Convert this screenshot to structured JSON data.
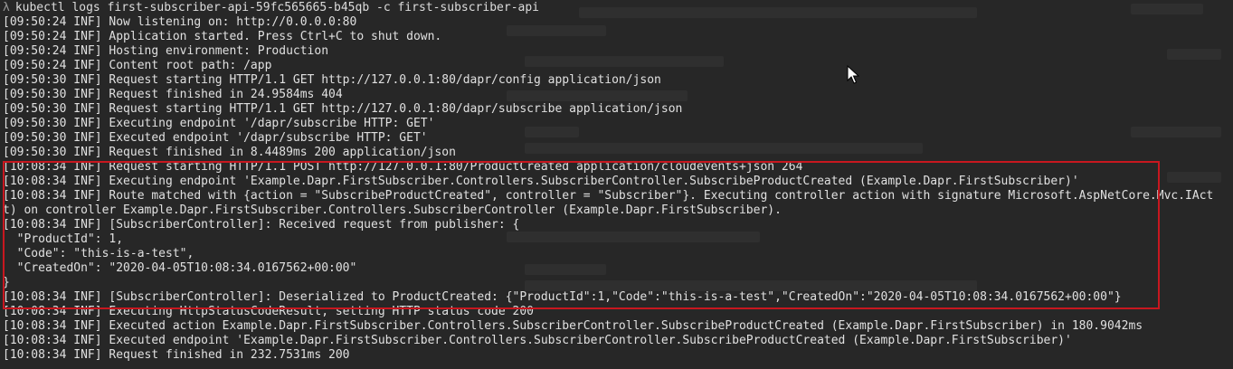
{
  "terminal": {
    "prompt_symbol": "λ",
    "command": "kubectl logs first-subscriber-api-59fc565665-b45qb -c first-subscriber-api",
    "lines": [
      "[09:50:24 INF] Now listening on: http://0.0.0.0:80",
      "[09:50:24 INF] Application started. Press Ctrl+C to shut down.",
      "[09:50:24 INF] Hosting environment: Production",
      "[09:50:24 INF] Content root path: /app",
      "[09:50:30 INF] Request starting HTTP/1.1 GET http://127.0.0.1:80/dapr/config application/json",
      "[09:50:30 INF] Request finished in 24.9584ms 404",
      "[09:50:30 INF] Request starting HTTP/1.1 GET http://127.0.0.1:80/dapr/subscribe application/json",
      "[09:50:30 INF] Executing endpoint '/dapr/subscribe HTTP: GET'",
      "[09:50:30 INF] Executed endpoint '/dapr/subscribe HTTP: GET'",
      "[09:50:30 INF] Request finished in 8.4489ms 200 application/json",
      "[10:08:34 INF] Request starting HTTP/1.1 POST http://127.0.0.1:80/ProductCreated application/cloudevents+json 264",
      "[10:08:34 INF] Executing endpoint 'Example.Dapr.FirstSubscriber.Controllers.SubscriberController.SubscribeProductCreated (Example.Dapr.FirstSubscriber)'",
      "[10:08:34 INF] Route matched with {action = \"SubscribeProductCreated\", controller = \"Subscriber\"}. Executing controller action with signature Microsoft.AspNetCore.Mvc.IAct",
      "t) on controller Example.Dapr.FirstSubscriber.Controllers.SubscriberController (Example.Dapr.FirstSubscriber).",
      "[10:08:34 INF] [SubscriberController]: Received request from publisher: {",
      "  \"ProductId\": 1,",
      "  \"Code\": \"this-is-a-test\",",
      "  \"CreatedOn\": \"2020-04-05T10:08:34.0167562+00:00\"",
      "}",
      "[10:08:34 INF] [SubscriberController]: Deserialized to ProductCreated: {\"ProductId\":1,\"Code\":\"this-is-a-test\",\"CreatedOn\":\"2020-04-05T10:08:34.0167562+00:00\"}",
      "[10:08:34 INF] Executing HttpStatusCodeResult, setting HTTP status code 200",
      "[10:08:34 INF] Executed action Example.Dapr.FirstSubscriber.Controllers.SubscriberController.SubscribeProductCreated (Example.Dapr.FirstSubscriber) in 180.9042ms",
      "[10:08:34 INF] Executed endpoint 'Example.Dapr.FirstSubscriber.Controllers.SubscriberController.SubscribeProductCreated (Example.Dapr.FirstSubscriber)'",
      "[10:08:34 INF] Request finished in 232.7531ms 200"
    ]
  },
  "colors": {
    "background": "#272727",
    "text": "#e0e0e0",
    "highlight_border": "#c8171f",
    "prompt_path": "#9bbf5a"
  },
  "icons": {
    "cursor": "mouse-pointer-icon"
  }
}
